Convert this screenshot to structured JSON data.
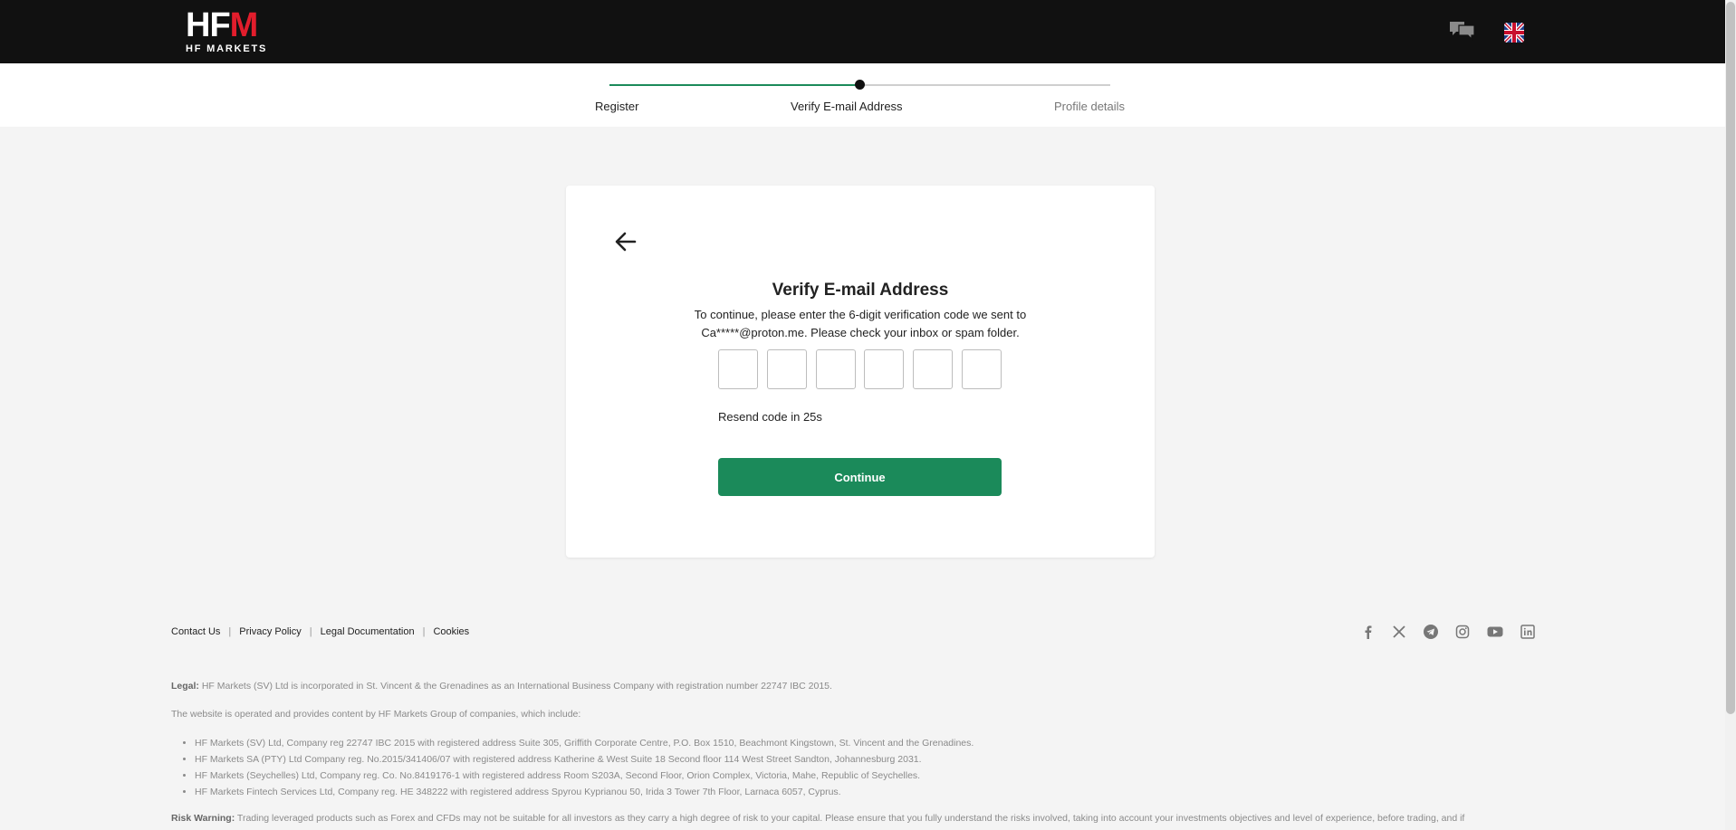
{
  "header": {
    "logo_text": "HFM",
    "logo_sub": "HF MARKETS",
    "chat_icon": "chat-bubbles-icon",
    "language_icon": "uk-flag-icon"
  },
  "stepper": {
    "steps": [
      {
        "label": "Register",
        "state": "done"
      },
      {
        "label": "Verify E-mail Address",
        "state": "current"
      },
      {
        "label": "Profile details",
        "state": "pending"
      }
    ],
    "progress_color": "#1b8a5a"
  },
  "card": {
    "back_icon": "arrow-left-icon",
    "title": "Verify E-mail Address",
    "description": "To continue, please enter the 6-digit verification code we sent to Ca*****@proton.me. Please check your inbox or spam folder.",
    "otp_values": [
      "",
      "",
      "",
      "",
      "",
      ""
    ],
    "resend_text": "Resend code in 25s",
    "continue_label": "Continue",
    "accent_color": "#1b8a5a"
  },
  "footer": {
    "links": [
      "Contact Us",
      "Privacy Policy",
      "Legal Documentation",
      "Cookies"
    ],
    "social_icons": [
      "facebook-icon",
      "x-icon",
      "telegram-icon",
      "instagram-icon",
      "youtube-icon",
      "linkedin-icon"
    ],
    "legal_label": "Legal:",
    "legal_text": " HF Markets (SV) Ltd is incorporated in St. Vincent & the Grenadines as an International Business Company with registration number 22747 IBC 2015.",
    "operated_text": "The website is operated and provides content by HF Markets Group of companies, which include:",
    "companies": [
      "HF Markets (SV) Ltd, Company reg 22747 IBC 2015 with registered address Suite 305, Griffith Corporate Centre, P.O. Box 1510, Beachmont Kingstown, St. Vincent and the Grenadines.",
      "HF Markets SA (PTY) Ltd Company reg. No.2015/341406/07 with registered address Katherine & West Suite 18 Second floor 114 West Street Sandton, Johannesburg 2031.",
      "HF Markets (Seychelles) Ltd, Company reg. Co. No.8419176-1 with registered address Room S203A, Second Floor, Orion Complex, Victoria, Mahe, Republic of Seychelles.",
      "HF Markets Fintech Services Ltd, Company reg. HE 348222 with registered address Spyrou Kyprianou 50, Irida 3 Tower 7th Floor, Larnaca 6057, Cyprus."
    ],
    "risk_label": "Risk Warning:",
    "risk_text": " Trading leveraged products such as Forex and CFDs may not be suitable for all investors as they carry a high degree of risk to your capital. Please ensure that you fully understand the risks involved, taking into account your investments objectives and level of experience, before trading, and if"
  }
}
